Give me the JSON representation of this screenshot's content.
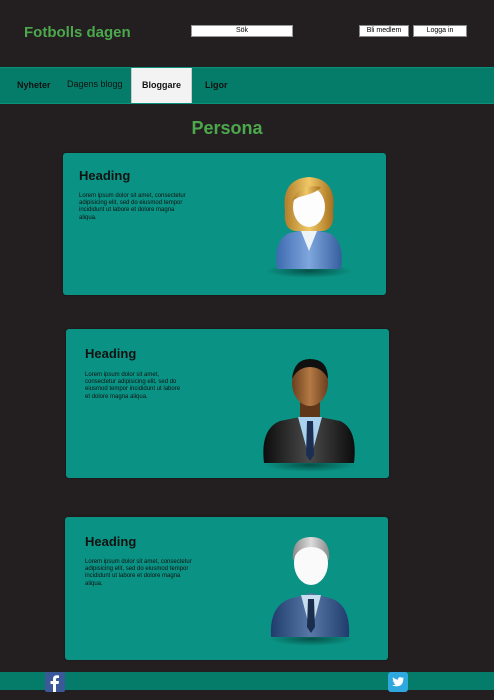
{
  "header": {
    "logo": "Fotbolls dagen",
    "search_label": "Sök",
    "member_label": "Bli medlem",
    "login_label": "Logga in"
  },
  "nav": {
    "items": [
      {
        "label": "Nyheter"
      },
      {
        "label": "Dagens blogg"
      },
      {
        "label": "Bloggare"
      },
      {
        "label": "Ligor"
      }
    ],
    "active": "Bloggare"
  },
  "page": {
    "title": "Persona"
  },
  "cards": [
    {
      "heading": "Heading",
      "text": "Lorem ipsum dolor sit amet, consectetur adipisicing elit, sed do eiusmod tempor incididunt ut labore et dolore magna aliqua.",
      "avatar": "woman-avatar-icon"
    },
    {
      "heading": "Heading",
      "text": "Lorem ipsum dolor sit amet, consectetur adipisicing elit, sed do eiusmod tempor incididunt ut labore et dolore magna aliqua.",
      "avatar": "man-avatar-icon"
    },
    {
      "heading": "Heading",
      "text": "Lorem ipsum dolor sit amet, consectetur adipisicing elit, sed do eiusmod tempor incididunt ut labore et dolore magna aliqua.",
      "avatar": "older-man-avatar-icon"
    }
  ],
  "footer": {
    "icons": [
      "facebook-icon",
      "twitter-icon"
    ]
  },
  "colors": {
    "background": "#231f20",
    "accent": "#057c69",
    "card": "#0a9384",
    "logo_green": "#4ca84c"
  }
}
